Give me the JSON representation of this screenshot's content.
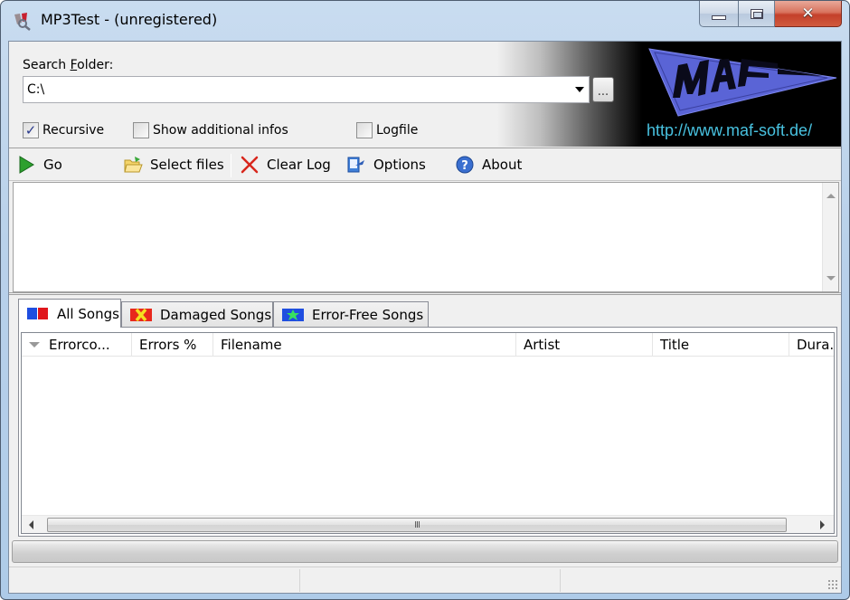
{
  "window": {
    "title": "MP3Test -  (unregistered)",
    "app_icon": "mp3test-app-icon",
    "controls": {
      "minimize": "minimize-icon",
      "maximize": "maximize-icon",
      "close": "close-icon",
      "close_glyph": "✕"
    }
  },
  "search": {
    "label_prefix": "Search ",
    "label_accel": "F",
    "label_suffix": "older:",
    "folder_value": "C:\\",
    "browse_label": "..."
  },
  "options": {
    "recursive": {
      "label": "Recursive",
      "checked": true
    },
    "show_additional_infos": {
      "label": "Show additional infos",
      "checked": false
    },
    "logfile": {
      "label": "Logfile",
      "checked": false
    }
  },
  "banner": {
    "logo_text": "MAF",
    "url": "http://www.maf-soft.de/",
    "colors": {
      "logo": "#5a64d6",
      "url": "#48c2e0",
      "background": "#000000"
    }
  },
  "toolbar": {
    "go": {
      "label": "Go",
      "icon": "play-icon"
    },
    "select_files": {
      "label": "Select files",
      "icon": "folder-icon"
    },
    "clear_log": {
      "label": "Clear Log",
      "icon": "red-x-icon"
    },
    "options": {
      "label": "Options",
      "icon": "options-icon"
    },
    "about": {
      "label": "About",
      "icon": "help-icon"
    }
  },
  "log": {
    "lines": []
  },
  "tabs": [
    {
      "label": "All Songs",
      "icon": "all-songs-icon",
      "active": true
    },
    {
      "label": "Damaged Songs",
      "icon": "damaged-songs-icon",
      "active": false
    },
    {
      "label": "Error-Free Songs",
      "icon": "error-free-songs-icon",
      "active": false
    }
  ],
  "grid": {
    "columns": [
      "Errorco...",
      "Errors %",
      "Filename",
      "Artist",
      "Title",
      "Dura."
    ],
    "rows": [],
    "sort_column": "Errorco...",
    "sort_direction": "descending",
    "hscroll_thumb_glyph": "III"
  },
  "progress": {
    "value": 0
  },
  "statusbar": {
    "panels": [
      "",
      "",
      ""
    ]
  }
}
